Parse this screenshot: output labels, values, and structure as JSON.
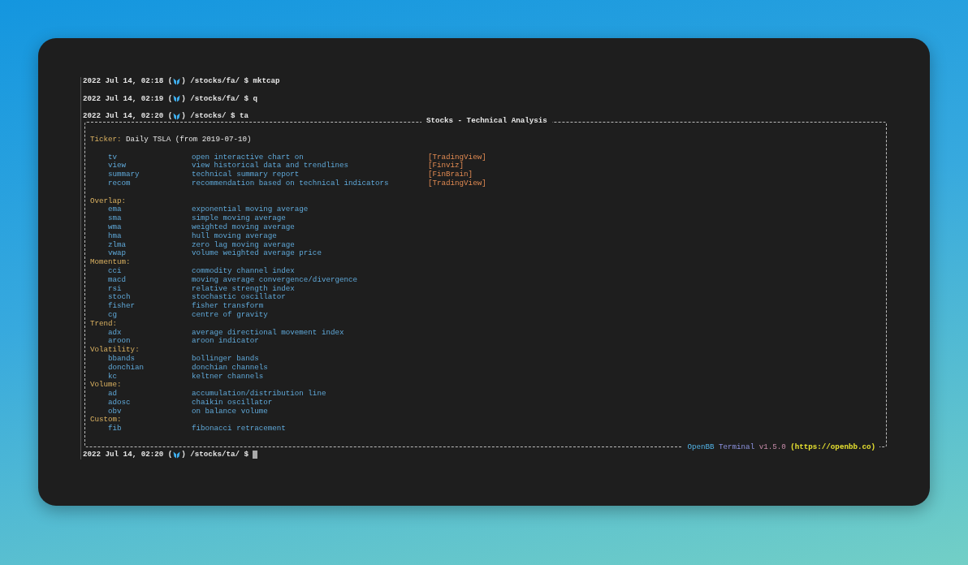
{
  "history": [
    {
      "before_icon": "2022 Jul 14, 02:18 (",
      "after_icon": ") /stocks/fa/ $ mktcap"
    },
    {
      "before_icon": "2022 Jul 14, 02:19 (",
      "after_icon": ") /stocks/fa/ $ q"
    },
    {
      "before_icon": "2022 Jul 14, 02:20 (",
      "after_icon": ") /stocks/ $ ta"
    }
  ],
  "panel": {
    "title": "Stocks - Technical Analysis",
    "ticker": {
      "label": "Ticker:",
      "value": "Daily TSLA (from 2019-07-10)"
    },
    "commands": [
      {
        "cmd": "tv",
        "description": "open interactive chart on",
        "source": "[TradingView]"
      },
      {
        "cmd": "view",
        "description": "view historical data and trendlines",
        "source": "[Finviz]"
      },
      {
        "cmd": "summary",
        "description": "technical summary report",
        "source": "[FinBrain]"
      },
      {
        "cmd": "recom",
        "description": "recommendation based on technical indicators",
        "source": "[TradingView]"
      }
    ],
    "sections": [
      {
        "title": "Overlap:",
        "commands": [
          {
            "cmd": "ema",
            "description": "exponential moving average"
          },
          {
            "cmd": "sma",
            "description": "simple moving average"
          },
          {
            "cmd": "wma",
            "description": "weighted moving average"
          },
          {
            "cmd": "hma",
            "description": "hull moving average"
          },
          {
            "cmd": "zlma",
            "description": "zero lag moving average"
          },
          {
            "cmd": "vwap",
            "description": "volume weighted average price"
          }
        ]
      },
      {
        "title": "Momentum:",
        "commands": [
          {
            "cmd": "cci",
            "description": "commodity channel index"
          },
          {
            "cmd": "macd",
            "description": "moving average convergence/divergence"
          },
          {
            "cmd": "rsi",
            "description": "relative strength index"
          },
          {
            "cmd": "stoch",
            "description": "stochastic oscillator"
          },
          {
            "cmd": "fisher",
            "description": "fisher transform"
          },
          {
            "cmd": "cg",
            "description": "centre of gravity"
          }
        ]
      },
      {
        "title": "Trend:",
        "commands": [
          {
            "cmd": "adx",
            "description": "average directional movement index"
          },
          {
            "cmd": "aroon",
            "description": "aroon indicator"
          }
        ]
      },
      {
        "title": "Volatility:",
        "commands": [
          {
            "cmd": "bbands",
            "description": "bollinger bands"
          },
          {
            "cmd": "donchian",
            "description": "donchian channels"
          },
          {
            "cmd": "kc",
            "description": "keltner channels"
          }
        ]
      },
      {
        "title": "Volume:",
        "commands": [
          {
            "cmd": "ad",
            "description": "accumulation/distribution line"
          },
          {
            "cmd": "adosc",
            "description": "chaikin oscillator"
          },
          {
            "cmd": "obv",
            "description": "on balance volume"
          }
        ]
      },
      {
        "title": "Custom:",
        "commands": [
          {
            "cmd": "fib",
            "description": "fibonacci retracement"
          }
        ]
      }
    ],
    "footer": {
      "brand": "OpenBB",
      "product": "Terminal",
      "version": "v1.5.0",
      "url": "(https://openbb.co)"
    }
  },
  "prompt": {
    "before_icon": "2022 Jul 14, 02:20 (",
    "after_icon": ") /stocks/ta/ $"
  }
}
